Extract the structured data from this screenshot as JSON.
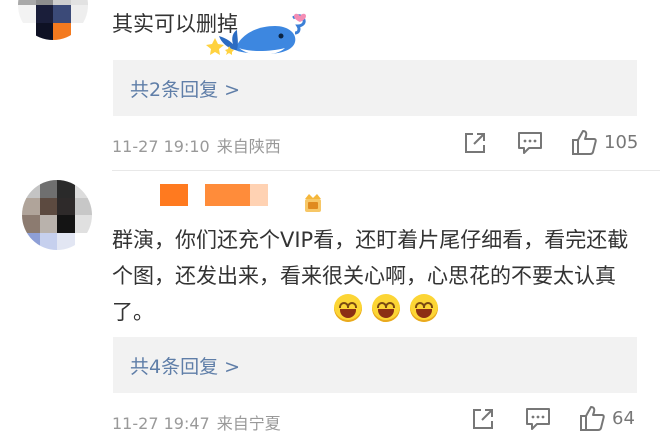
{
  "comments": [
    {
      "text": "其实可以删掉",
      "reply_link": "共2条回复 >",
      "date": "11-27",
      "time": "19:10",
      "location": "来自陕西",
      "like_count": "105"
    },
    {
      "text": "群演，你们还充个VIP看，还盯着片尾仔细看，看完还截个图，还发出来，看来很关心啊，心思花的不要太认真了。",
      "reply_link": "共4条回复 >",
      "date": "11-27",
      "time": "19:47",
      "location": "来自宁夏",
      "like_count": "64"
    }
  ],
  "icons": {
    "share": "share-icon",
    "comment": "comment-icon",
    "like": "thumbs-up-icon",
    "sticker": "whale-sticker",
    "badge": "user-badge-icon",
    "emoji": "grinning-face-emoji"
  },
  "colors": {
    "reply_link": "#5f7ea8",
    "reply_bg": "#f2f2f2",
    "meta": "#999999",
    "redacted_name": "#ff7a1f"
  }
}
